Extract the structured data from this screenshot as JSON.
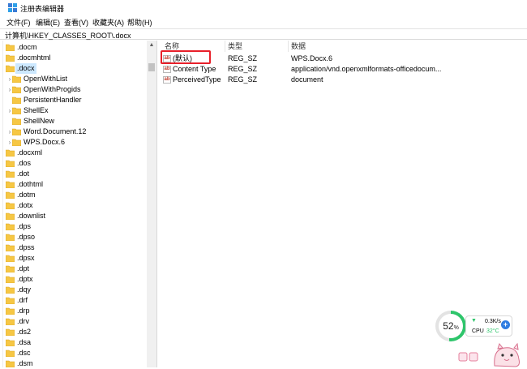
{
  "window": {
    "title": "注册表编辑器"
  },
  "menu": [
    {
      "label": "文件(F)"
    },
    {
      "label": "编辑(E)"
    },
    {
      "label": "查看(V)"
    },
    {
      "label": "收藏夹(A)"
    },
    {
      "label": "帮助(H)"
    }
  ],
  "address": {
    "path": "计算机\\HKEY_CLASSES_ROOT\\.docx"
  },
  "tree": {
    "items": [
      {
        "label": ".docm",
        "level": 0,
        "expander": false,
        "selected": false
      },
      {
        "label": ".docmhtml",
        "level": 0,
        "expander": false,
        "selected": false
      },
      {
        "label": ".docx",
        "level": 0,
        "expander": false,
        "selected": true
      },
      {
        "label": "OpenWithList",
        "level": 1,
        "expander": true,
        "selected": false
      },
      {
        "label": "OpenWithProgids",
        "level": 1,
        "expander": true,
        "selected": false
      },
      {
        "label": "PersistentHandler",
        "level": 1,
        "expander": false,
        "selected": false
      },
      {
        "label": "ShellEx",
        "level": 1,
        "expander": true,
        "selected": false
      },
      {
        "label": "ShellNew",
        "level": 1,
        "expander": false,
        "selected": false
      },
      {
        "label": "Word.Document.12",
        "level": 1,
        "expander": true,
        "selected": false
      },
      {
        "label": "WPS.Docx.6",
        "level": 1,
        "expander": true,
        "selected": false
      },
      {
        "label": ".docxml",
        "level": 0,
        "expander": false,
        "selected": false
      },
      {
        "label": ".dos",
        "level": 0,
        "expander": false,
        "selected": false
      },
      {
        "label": ".dot",
        "level": 0,
        "expander": false,
        "selected": false
      },
      {
        "label": ".dothtml",
        "level": 0,
        "expander": false,
        "selected": false
      },
      {
        "label": ".dotm",
        "level": 0,
        "expander": false,
        "selected": false
      },
      {
        "label": ".dotx",
        "level": 0,
        "expander": false,
        "selected": false
      },
      {
        "label": ".downlist",
        "level": 0,
        "expander": false,
        "selected": false
      },
      {
        "label": ".dps",
        "level": 0,
        "expander": false,
        "selected": false
      },
      {
        "label": ".dpso",
        "level": 0,
        "expander": false,
        "selected": false
      },
      {
        "label": ".dpss",
        "level": 0,
        "expander": false,
        "selected": false
      },
      {
        "label": ".dpsx",
        "level": 0,
        "expander": false,
        "selected": false
      },
      {
        "label": ".dpt",
        "level": 0,
        "expander": false,
        "selected": false
      },
      {
        "label": ".dptx",
        "level": 0,
        "expander": false,
        "selected": false
      },
      {
        "label": ".dqy",
        "level": 0,
        "expander": false,
        "selected": false
      },
      {
        "label": ".drf",
        "level": 0,
        "expander": false,
        "selected": false
      },
      {
        "label": ".drp",
        "level": 0,
        "expander": false,
        "selected": false
      },
      {
        "label": ".drv",
        "level": 0,
        "expander": false,
        "selected": false
      },
      {
        "label": ".ds2",
        "level": 0,
        "expander": false,
        "selected": false
      },
      {
        "label": ".dsa",
        "level": 0,
        "expander": false,
        "selected": false
      },
      {
        "label": ".dsc",
        "level": 0,
        "expander": false,
        "selected": false
      },
      {
        "label": ".dsm",
        "level": 0,
        "expander": false,
        "selected": false
      }
    ]
  },
  "values": {
    "columns": [
      "名称",
      "类型",
      "数据"
    ],
    "rows": [
      {
        "name": "(默认)",
        "type": "REG_SZ",
        "data": "WPS.Docx.6",
        "icon": "string-value-icon"
      },
      {
        "name": "Content Type",
        "type": "REG_SZ",
        "data": "application/vnd.openxmlformats-officedocum...",
        "icon": "string-value-icon"
      },
      {
        "name": "PerceivedType",
        "type": "REG_SZ",
        "data": "document",
        "icon": "string-value-icon"
      }
    ],
    "icon_text": "ab"
  },
  "widget": {
    "cpu_percent": "52",
    "cpu_percent_sign": "%",
    "net_speed": "0.3K/s",
    "cpu_label": "CPU",
    "cpu_temp": "32°C",
    "plus": "+"
  },
  "colors": {
    "selection": "#cce8ff",
    "highlight": "#e8202a",
    "folder": "#f6c744",
    "cpu_ring": "#2ec56b"
  }
}
